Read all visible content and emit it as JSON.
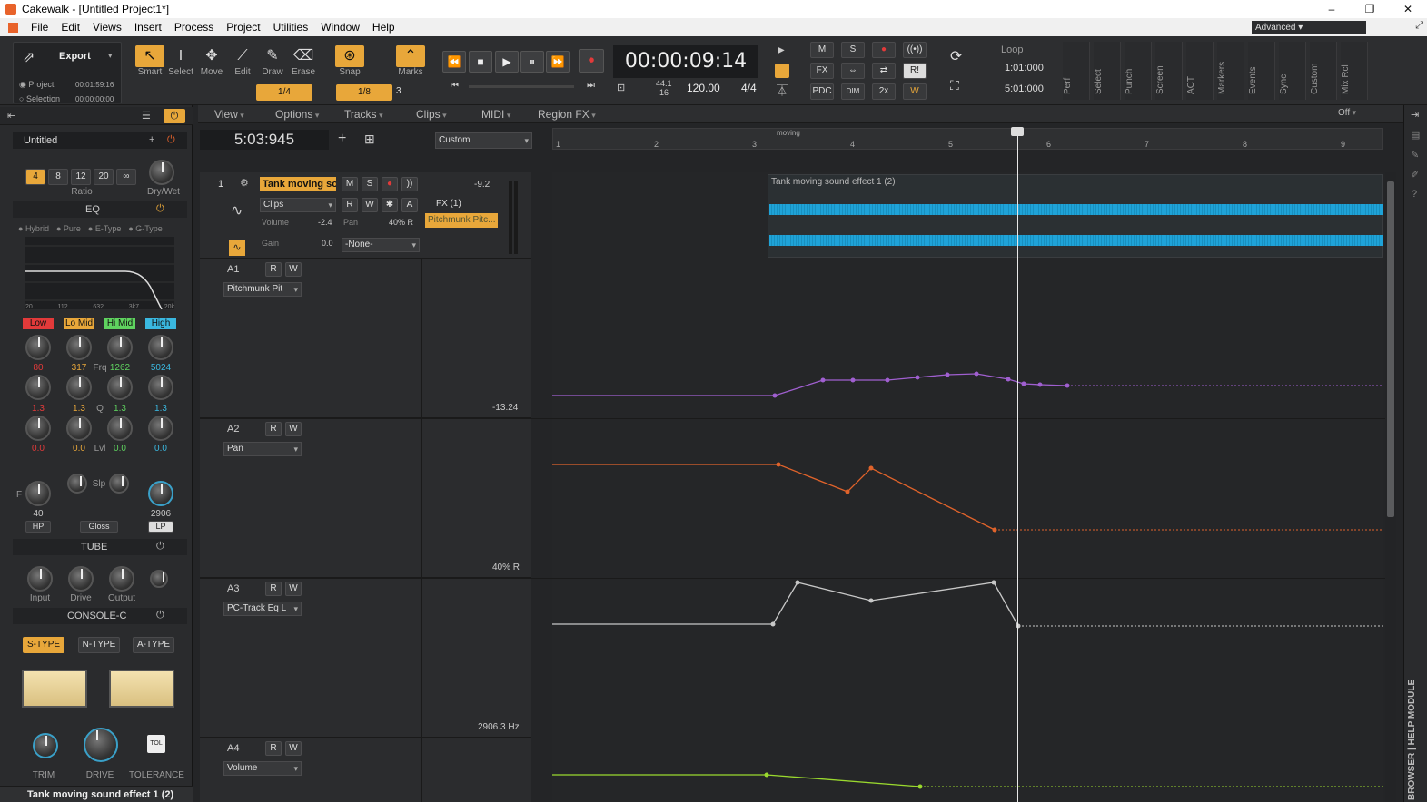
{
  "window": {
    "title": "Cakewalk - [Untitled Project1*]",
    "controls": [
      "–",
      "❐",
      "✕"
    ]
  },
  "menu": {
    "items": [
      "File",
      "Edit",
      "Views",
      "Insert",
      "Process",
      "Project",
      "Utilities",
      "Window",
      "Help"
    ],
    "workspace": "Advanced"
  },
  "toolbar": {
    "export_label": "Export",
    "project_label": "Project",
    "project_time": "00:01:59:16",
    "selection_label": "Selection",
    "selection_time": "00:00:00:00",
    "tools": [
      {
        "label": "Smart",
        "icon": "↖"
      },
      {
        "label": "Select",
        "icon": "I"
      },
      {
        "label": "Move",
        "icon": "✥"
      },
      {
        "label": "Edit",
        "icon": "⟋"
      },
      {
        "label": "Draw",
        "icon": "✎"
      },
      {
        "label": "Erase",
        "icon": "⌫"
      }
    ],
    "snap_label": "Snap",
    "marks_label": "Marks",
    "snap_value": "1/4",
    "grid_value": "1/8",
    "grid_num": "3",
    "time": "00:00:09:14",
    "sample_rate": "44.1",
    "bit_depth": "16",
    "tempo": "120.00",
    "meter": "4/4",
    "mix_buttons": [
      "M",
      "S",
      "●",
      "((•))",
      "FX",
      "⇔",
      "⇄",
      "R!",
      "PDC",
      "DIM",
      "2x",
      "W"
    ],
    "loop_label": "Loop",
    "loop_start": "1:01:000",
    "loop_end": "5:01:000",
    "modules": [
      "Perf",
      "Select",
      "Punch",
      "Screen",
      "ACT",
      "Markers",
      "Events",
      "Sync",
      "Custom",
      "Mix Rcl"
    ]
  },
  "subbar": {
    "items": [
      "View",
      "Options",
      "Tracks",
      "Clips",
      "MIDI",
      "Region FX"
    ],
    "off_label": "Off"
  },
  "inspector": {
    "preset": "Untitled",
    "ratio_values": [
      "4",
      "8",
      "12",
      "20",
      "∞"
    ],
    "ratio_label": "Ratio",
    "drywet_label": "Dry/Wet",
    "eq_label": "EQ",
    "eq_modes": [
      "Hybrid",
      "Pure",
      "E-Type",
      "G-Type"
    ],
    "eq_freq_ticks": [
      "20",
      "112",
      "632",
      "3k7",
      "20k"
    ],
    "bands": [
      {
        "name": "Low",
        "color": "#e23a3a",
        "freq": "80",
        "q": "1.3",
        "lvl": "0.0"
      },
      {
        "name": "Lo Mid",
        "color": "#e8a73a",
        "freq": "317",
        "q": "1.3",
        "lvl": "0.0"
      },
      {
        "name": "Hi Mid",
        "color": "#5fd35f",
        "freq": "1262",
        "q": "1.3",
        "lvl": "0.0"
      },
      {
        "name": "High",
        "color": "#3ab8e0",
        "freq": "5024",
        "q": "1.3",
        "lvl": "0.0"
      }
    ],
    "frq_label": "Frq",
    "q_label": "Q",
    "lvl_label": "Lvl",
    "hp_value": "40",
    "lp_value": "2906",
    "hp_label": "HP",
    "gloss_label": "Gloss",
    "lp_label": "LP",
    "slp_label": "Slp",
    "f_label": "F",
    "tube_label": "TUBE",
    "tube_knobs": [
      "Input",
      "Drive",
      "Output"
    ],
    "console_label": "CONSOLE-C",
    "console_types": [
      "S-TYPE",
      "N-TYPE",
      "A-TYPE"
    ],
    "console_knobs": [
      "TRIM",
      "DRIVE",
      "TOLERANCE"
    ],
    "tol_label": "TOL",
    "clip_name": "Tank moving sound effect 1 (2)"
  },
  "clock2": "5:03:945",
  "view_preset": "Custom",
  "timeline": {
    "marker": "moving",
    "ticks": [
      "1",
      "2",
      "3",
      "4",
      "5",
      "6",
      "7",
      "8",
      "9"
    ]
  },
  "track": {
    "number": "1",
    "name": "Tank moving sou",
    "mode": "Clips",
    "volume_label": "Volume",
    "volume_value": "-2.4",
    "pan_label": "Pan",
    "pan_value": "40% R",
    "gain_label": "Gain",
    "gain_value": "0.0",
    "fx_label": "FX (1)",
    "fx_plugin": "Pitchmunk Pitc...",
    "db_value": "-9.2",
    "input": "-None-",
    "clip_title": "Tank moving sound effect 1 (2)"
  },
  "lanes": [
    {
      "id": "A1",
      "param": "Pitchmunk Pit",
      "value": "-13.24",
      "color": "#a05fd0"
    },
    {
      "id": "A2",
      "param": "Pan",
      "value": "40% R",
      "color": "#e0632b"
    },
    {
      "id": "A3",
      "param": "PC-Track Eq L",
      "value": "2906.3 Hz",
      "color": "#c8c8c8"
    },
    {
      "id": "A4",
      "param": "Volume",
      "value": "",
      "color": "#9ad92e"
    }
  ],
  "right_strip": {
    "label": "BROWSER | HELP MODULE"
  }
}
